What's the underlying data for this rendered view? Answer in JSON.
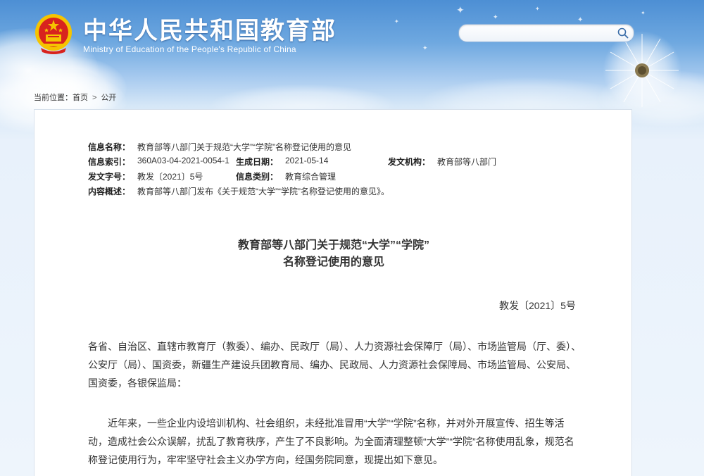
{
  "site": {
    "title": "中华人民共和国教育部",
    "subtitle": "Ministry of Education of the People's Republic of China"
  },
  "search": {
    "value": "",
    "placeholder": ""
  },
  "breadcrumb": {
    "label": "当前位置：",
    "home": "首页",
    "separator": ">",
    "current": "公开"
  },
  "meta": {
    "name_label": "信息名称：",
    "name_value": "教育部等八部门关于规范“大学”“学院”名称登记使用的意见",
    "index_label": "信息索引：",
    "index_value": "360A03-04-2021-0054-1",
    "date_label": "生成日期：",
    "date_value": "2021-05-14",
    "org_label": "发文机构：",
    "org_value": "教育部等八部门",
    "docno_label": "发文字号：",
    "docno_value": "教发〔2021〕5号",
    "category_label": "信息类别：",
    "category_value": "教育综合管理",
    "summary_label": "内容概述：",
    "summary_value": "教育部等八部门发布《关于规范“大学”“学院”名称登记使用的意见》。"
  },
  "document": {
    "title_line1": "教育部等八部门关于规范“大学”“学院”",
    "title_line2": "名称登记使用的意见",
    "number": "教发〔2021〕5号",
    "addressee": "各省、自治区、直辖市教育厅（教委）、编办、民政厅（局）、人力资源社会保障厅（局）、市场监管局（厅、委）、公安厅（局）、国资委，新疆生产建设兵团教育局、编办、民政局、人力资源社会保障局、市场监管局、公安局、国资委，各银保监局：",
    "paragraph1": "近年来，一些企业内设培训机构、社会组织，未经批准冒用“大学”“学院”名称，并对外开展宣传、招生等活动，造成社会公众误解，扰乱了教育秩序，产生了不良影响。为全面清理整顿“大学”“学院”名称使用乱象，规范名称登记使用行为，牢牢坚守社会主义办学方向，经国务院同意，现提出如下意见。"
  },
  "colors": {
    "sky_top": "#4d8fd4",
    "sky_bottom": "#eef5fc",
    "emblem_red": "#d8231e",
    "emblem_gold": "#f5c400",
    "text": "#333333"
  },
  "icons": {
    "search": "search-icon",
    "emblem": "national-emblem-icon",
    "dandelion": "dandelion-decoration"
  }
}
